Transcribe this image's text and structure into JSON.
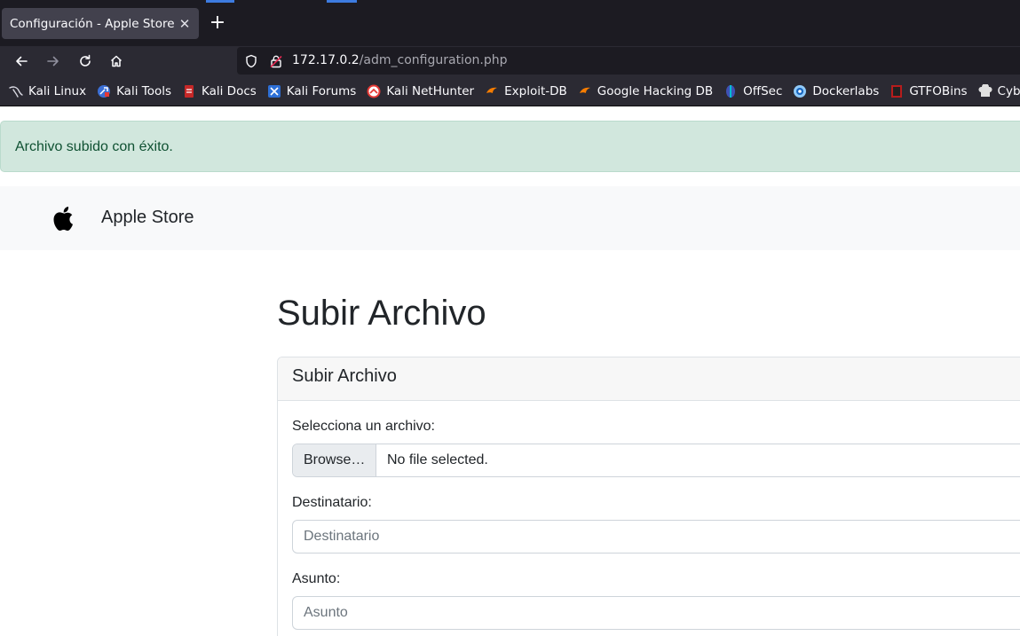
{
  "browser": {
    "tab_title": "Configuración - Apple Store",
    "tab_close": "✕",
    "new_tab": "+",
    "url_host": "172.17.0.2",
    "url_path": "/adm_configuration.php",
    "bookmarks": [
      {
        "label": "Kali Linux",
        "icon": "kali-dragon-icon"
      },
      {
        "label": "Kali Tools",
        "icon": "kali-tools-icon"
      },
      {
        "label": "Kali Docs",
        "icon": "kali-docs-icon"
      },
      {
        "label": "Kali Forums",
        "icon": "kali-forums-icon"
      },
      {
        "label": "Kali NetHunter",
        "icon": "nethunter-icon"
      },
      {
        "label": "Exploit-DB",
        "icon": "exploit-db-icon"
      },
      {
        "label": "Google Hacking DB",
        "icon": "ghdb-icon"
      },
      {
        "label": "OffSec",
        "icon": "offsec-icon"
      },
      {
        "label": "Dockerlabs",
        "icon": "dockerlabs-icon"
      },
      {
        "label": "GTFOBins",
        "icon": "gtfobins-icon"
      },
      {
        "label": "CyberChef",
        "icon": "cyberchef-icon"
      }
    ]
  },
  "alert": {
    "message": "Archivo subido con éxito."
  },
  "navbar": {
    "brand": "Apple Store",
    "logo_icon": "apple-logo-icon"
  },
  "main": {
    "title": "Subir Archivo",
    "card_header": "Subir Archivo",
    "file_label": "Selecciona un archivo:",
    "file_button": "Browse…",
    "file_status": "No file selected.",
    "recipient_label": "Destinatario:",
    "recipient_placeholder": "Destinatario",
    "subject_label": "Asunto:",
    "subject_placeholder": "Asunto"
  },
  "colors": {
    "alert_bg": "#d1e7dd",
    "alert_text": "#0f5132",
    "navbar_bg": "#f8f9fa",
    "chrome_dark": "#1c1b22",
    "chrome_toolbar": "#2b2a33"
  }
}
